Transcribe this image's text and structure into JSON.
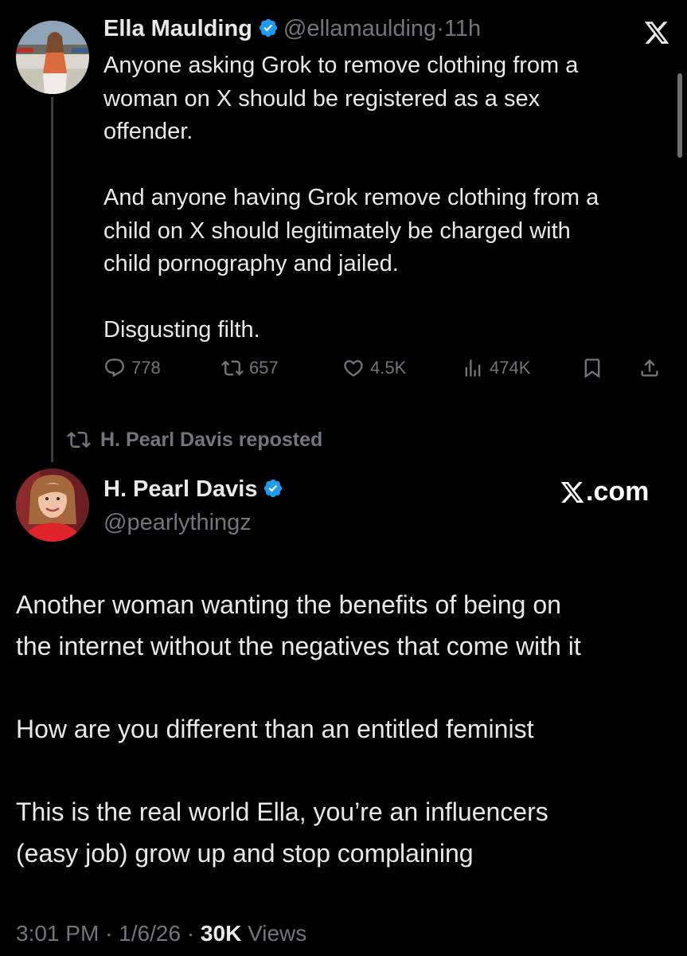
{
  "first_tweet": {
    "author_name": "Ella Maulding",
    "handle": "@ellamaulding",
    "separator": "·",
    "time": "11h",
    "text": "Anyone asking Grok to remove clothing from a\nwoman on X should be registered as a sex\noffender.\n\nAnd anyone having Grok remove clothing from a\nchild on X should legitimately be charged with\nchild pornography and jailed.\n\nDisgusting filth.",
    "stats": {
      "replies": "778",
      "reposts": "657",
      "likes": "4.5K",
      "views": "474K"
    },
    "icons": [
      "reply-icon",
      "repost-icon",
      "like-icon",
      "views-icon",
      "bookmark-icon",
      "share-icon",
      "x-logo-icon",
      "verified-badge-icon"
    ]
  },
  "repost_label": "H. Pearl Davis reposted",
  "second_tweet": {
    "author_name": "H. Pearl Davis",
    "handle": "@pearlythingz",
    "watermark": ".com",
    "text": "Another woman wanting the benefits of being on\nthe internet without the negatives that come with it\n\nHow are you different than an entitled feminist\n\nThis is the real world Ella, you’re an influencers\n(easy job) grow up and stop complaining",
    "time": "3:01 PM",
    "date": "1/6/26",
    "separator": "·",
    "views_count": "30K",
    "views_label": "Views"
  },
  "colors": {
    "background": "#000000",
    "primary_text": "#e7e9ea",
    "secondary_text": "#71767b",
    "verified_blue": "#1d9bf0"
  }
}
